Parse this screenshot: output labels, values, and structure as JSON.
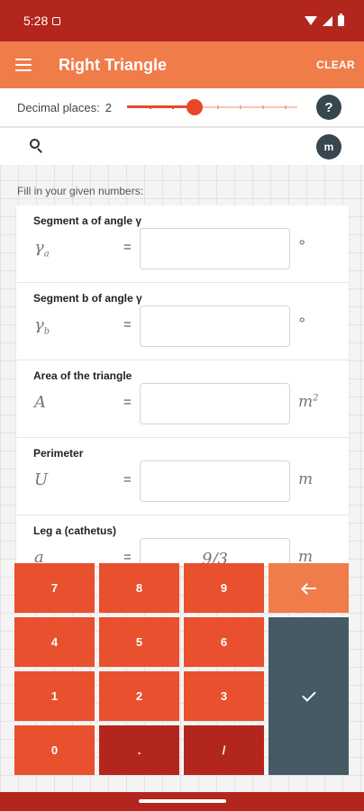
{
  "status": {
    "time": "5:28"
  },
  "appbar": {
    "title": "Right Triangle",
    "clear_label": "CLEAR"
  },
  "decimal": {
    "label": "Decimal places:",
    "value": "2",
    "help_label": "?"
  },
  "search": {
    "unit_label": "m"
  },
  "instructions": "Fill in your given numbers:",
  "fields": [
    {
      "title": "Segment a of angle γ",
      "symbol": "γ",
      "sub": "a",
      "unit": "°",
      "unit_sup": "",
      "value": ""
    },
    {
      "title": "Segment b of angle γ",
      "symbol": "γ",
      "sub": "b",
      "unit": "°",
      "unit_sup": "",
      "value": ""
    },
    {
      "title": "Area of the triangle",
      "symbol": "A",
      "sub": "",
      "unit": "m",
      "unit_sup": "2",
      "value": ""
    },
    {
      "title": "Perimeter",
      "symbol": "U",
      "sub": "",
      "unit": "m",
      "unit_sup": "",
      "value": ""
    },
    {
      "title": "Leg a (cathetus)",
      "symbol": "a",
      "sub": "",
      "unit": "m",
      "unit_sup": "",
      "value": "9/3"
    }
  ],
  "field_eq": "=",
  "keypad": {
    "k7": "7",
    "k8": "8",
    "k9": "9",
    "k4": "4",
    "k5": "5",
    "k6": "6",
    "k1": "1",
    "k2": "2",
    "k3": "3",
    "k0": "0",
    "dot": ".",
    "slash": "/"
  },
  "colors": {
    "status_bar": "#b3261e",
    "app_bar": "#f07c4a",
    "accent": "#e8502e",
    "key_dark": "#b3261e",
    "enter_key": "#455a64",
    "fab_dark": "#37474f"
  },
  "icons": [
    "menu-icon",
    "search-icon",
    "backspace-icon",
    "check-icon",
    "wifi-icon",
    "signal-icon",
    "battery-icon"
  ]
}
